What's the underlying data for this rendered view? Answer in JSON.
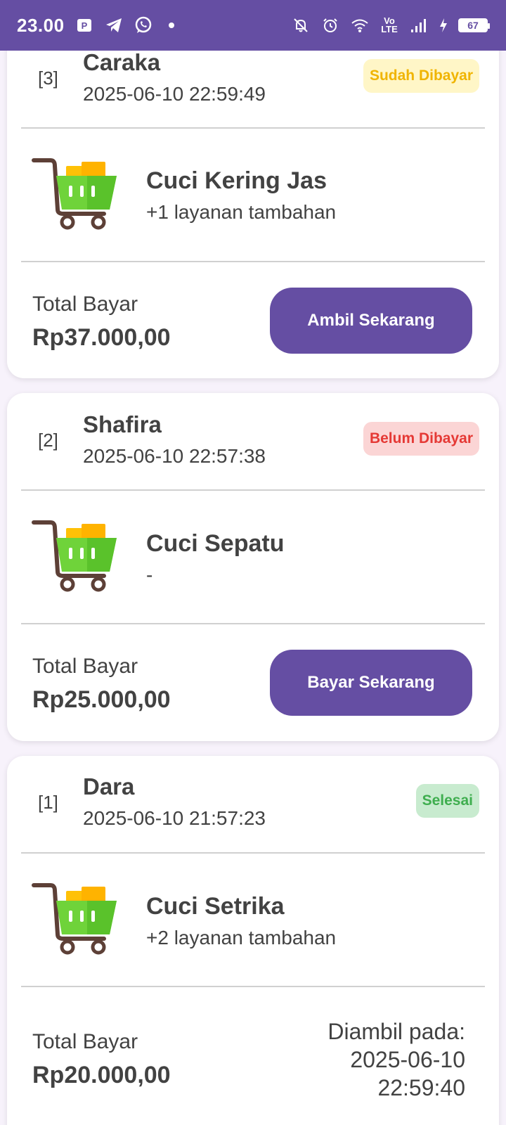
{
  "status_bar": {
    "time": "23.00",
    "lte_top": "Vo",
    "lte_bottom": "LTE",
    "battery": "67"
  },
  "orders": [
    {
      "number": "[3]",
      "customer": "Caraka",
      "datetime": "2025-06-10 22:59:49",
      "status": "Sudah Dibayar",
      "service": "Cuci Kering Jas",
      "extras": "+1 layanan tambahan",
      "total_label": "Total Bayar",
      "total": "Rp37.000,00",
      "action": "Ambil Sekarang"
    },
    {
      "number": "[2]",
      "customer": "Shafira",
      "datetime": "2025-06-10 22:57:38",
      "status": "Belum Dibayar",
      "service": "Cuci Sepatu",
      "extras": "-",
      "total_label": "Total Bayar",
      "total": "Rp25.000,00",
      "action": "Bayar Sekarang"
    },
    {
      "number": "[1]",
      "customer": "Dara",
      "datetime": "2025-06-10 21:57:23",
      "status": "Selesai",
      "service": "Cuci Setrika",
      "extras": "+2 layanan tambahan",
      "total_label": "Total Bayar",
      "total": "Rp20.000,00",
      "picked_label": "Diambil pada:",
      "picked_date": "2025-06-10",
      "picked_time": "22:59:40"
    }
  ],
  "colors": {
    "primary": "#654ea3",
    "paid_bg": "#fff6c7",
    "paid_text": "#f0b400",
    "unpaid_bg": "#fbd5d5",
    "unpaid_text": "#e53935",
    "done_bg": "#c8ebcf",
    "done_text": "#3fae4f"
  },
  "icons": {
    "status": [
      "parking-app-icon",
      "telegram-icon",
      "whatsapp-icon",
      "notification-dot",
      "bell-off-icon",
      "alarm-icon",
      "wifi-icon",
      "signal-icon",
      "charging-icon",
      "battery-icon"
    ],
    "order": "shopping-cart-icon"
  }
}
